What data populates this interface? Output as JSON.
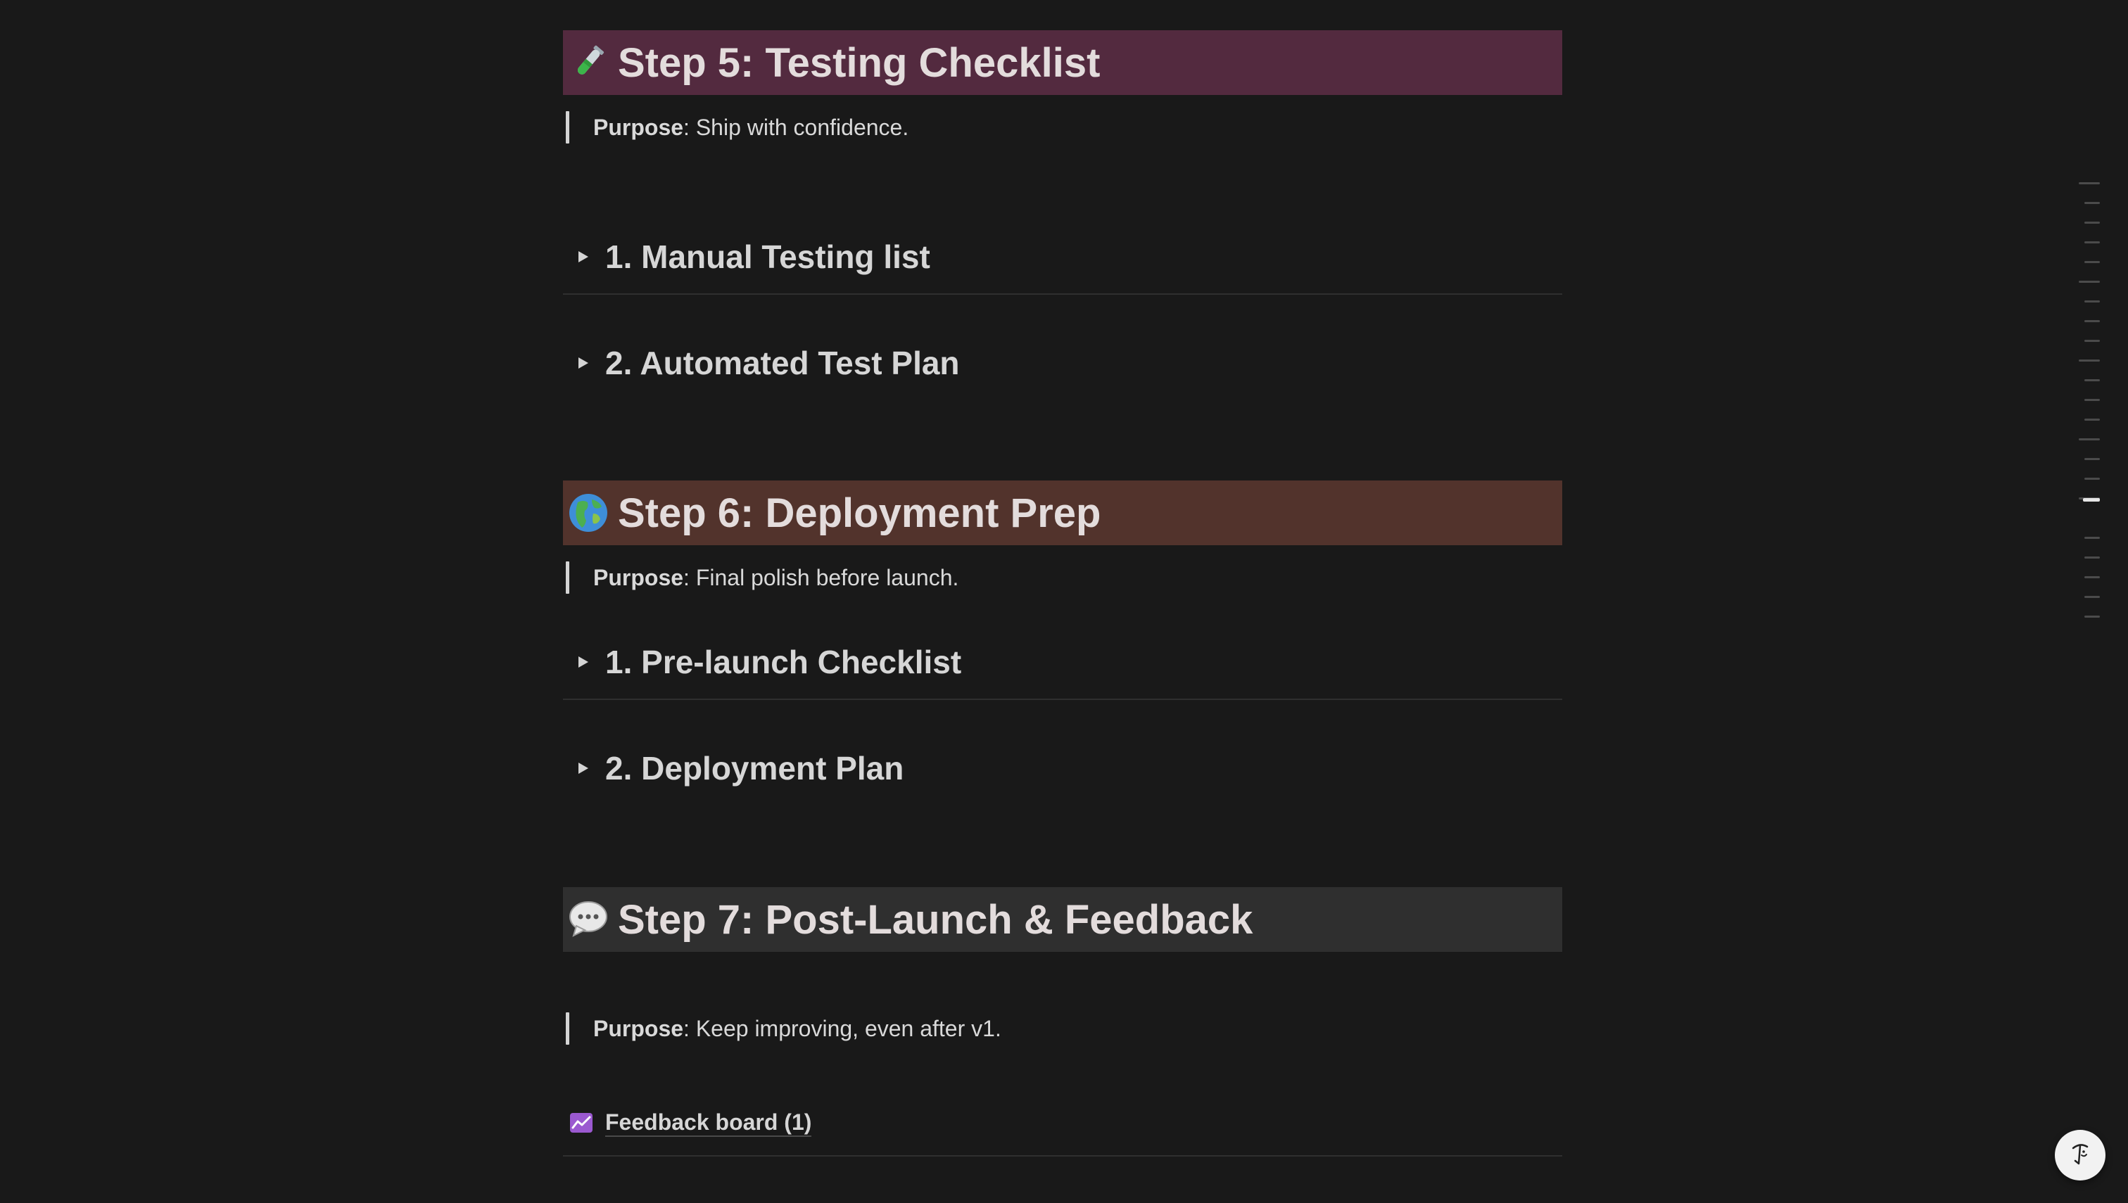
{
  "colors": {
    "background": "#191919",
    "step5_bg": "#532a3f",
    "step6_bg": "#52332c",
    "step7_bg": "#2f2f2f"
  },
  "step5": {
    "emoji_icon": "test-tube-icon",
    "title": "Step 5: Testing Checklist",
    "purpose_label": "Purpose",
    "purpose_text": ": Ship with confidence.",
    "toggles": [
      {
        "label": "1. Manual Testing list"
      },
      {
        "label": "2. Automated Test Plan"
      }
    ]
  },
  "step6": {
    "emoji_icon": "globe-icon",
    "title": "Step 6: Deployment Prep",
    "purpose_label": "Purpose",
    "purpose_text": ": Final polish before launch.",
    "toggles": [
      {
        "label": "1. Pre-launch Checklist"
      },
      {
        "label": "2. Deployment Plan"
      }
    ]
  },
  "step7": {
    "emoji_icon": "speech-bubble-icon",
    "title": "Step 7: Post-Launch & Feedback",
    "purpose_label": "Purpose",
    "purpose_text": ": Keep improving, even after v1.",
    "db_link": {
      "icon": "chart-icon",
      "label": "Feedback board (1)"
    }
  },
  "toc": {
    "icon": "table-of-contents-icon"
  },
  "help": {
    "icon": "help-icon"
  }
}
